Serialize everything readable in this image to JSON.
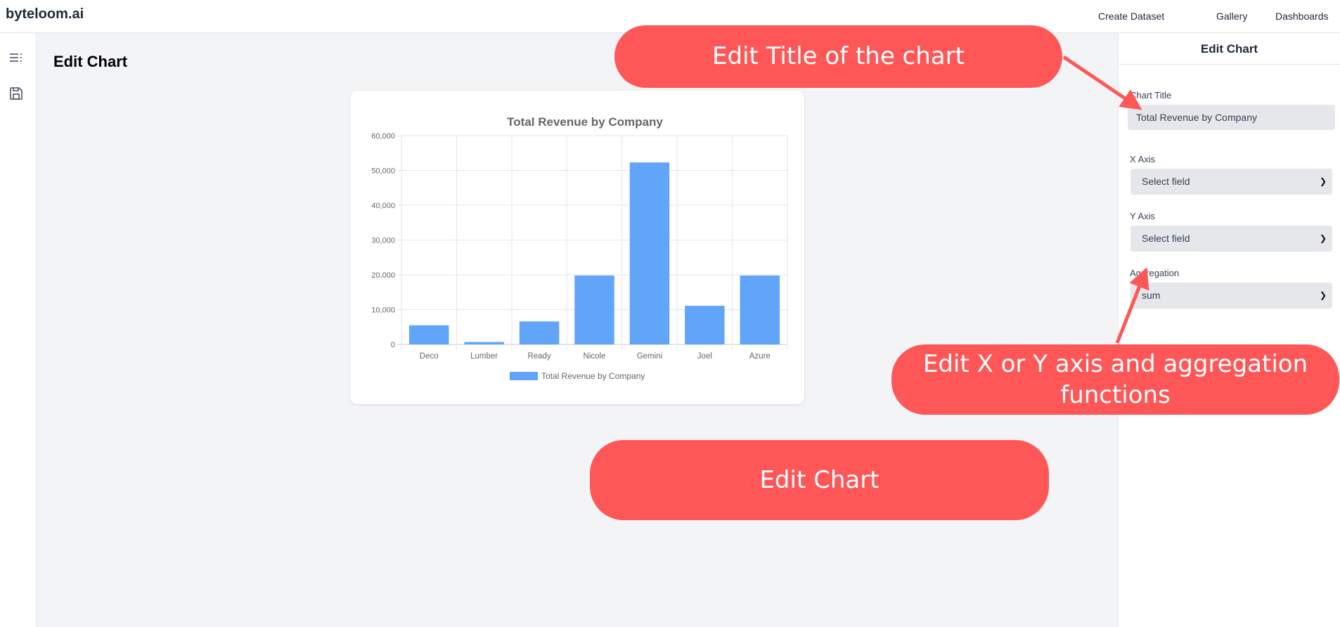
{
  "header": {
    "brand": "byteloom.ai",
    "nav": [
      "Create Dataset",
      "Gallery",
      "Dashboards"
    ]
  },
  "sidebar": {
    "icons": [
      "list-icon",
      "save-icon"
    ]
  },
  "main": {
    "title": "Edit Chart"
  },
  "panel": {
    "title": "Edit Chart",
    "chart_title_label": "Chart Title",
    "chart_title_value": "Total Revenue by Company",
    "x_axis_label": "X Axis",
    "x_axis_value": "Select field",
    "y_axis_label": "Y Axis",
    "y_axis_value": "Select field",
    "aggregation_label": "Aggregation",
    "aggregation_value": "sum"
  },
  "annotations": {
    "title": "Edit Title of the chart",
    "axes": "Edit X or Y axis and aggregation functions",
    "chart": "Edit Chart",
    "color": "#ff5757"
  },
  "chart_data": {
    "type": "bar",
    "title": "Total Revenue by Company",
    "categories": [
      "Deco",
      "Lumber",
      "Ready",
      "Nicole",
      "Gemini",
      "Joel",
      "Azure"
    ],
    "series": [
      {
        "name": "Total Revenue by Company",
        "values": [
          5500,
          700,
          6600,
          19800,
          52300,
          11100,
          19800
        ],
        "color": "#60a5fa"
      }
    ],
    "yticks": [
      "0",
      "10,000",
      "20,000",
      "30,000",
      "40,000",
      "50,000",
      "60,000"
    ],
    "ylim": [
      0,
      60000
    ],
    "xlabel": "",
    "ylabel": "",
    "grid": true,
    "legend": "bottom"
  }
}
